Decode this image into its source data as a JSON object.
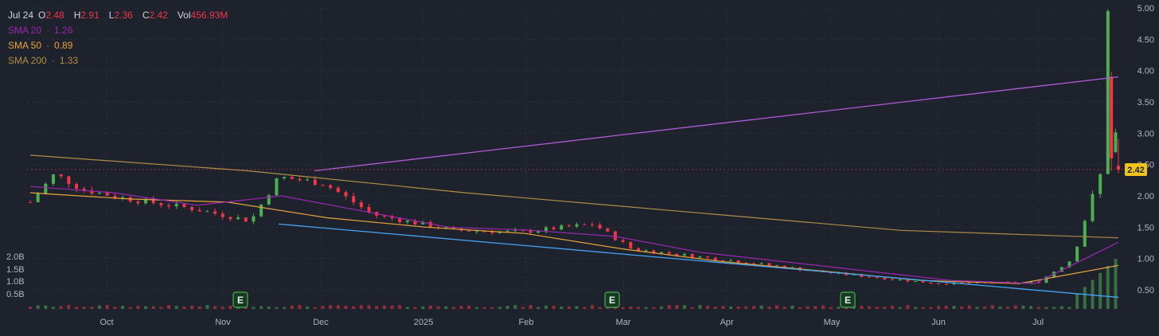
{
  "legend": {
    "date": "Jul 24",
    "ohlc": [
      {
        "key": "O",
        "value": "2.48"
      },
      {
        "key": "H",
        "value": "2.91"
      },
      {
        "key": "L",
        "value": "2.36"
      },
      {
        "key": "C",
        "value": "2.42"
      },
      {
        "key": "Vol",
        "value": "456.93M"
      }
    ],
    "sma": [
      {
        "label": "SMA 20",
        "value": "1.26",
        "color": "#9c27b0"
      },
      {
        "label": "SMA 50",
        "value": "0.89",
        "color": "#e8a33a"
      },
      {
        "label": "SMA 200",
        "value": "1.33",
        "color": "#b08d45"
      }
    ]
  },
  "colors": {
    "up": "#26a69a",
    "up_candle": "#4caf50",
    "down": "#f23645",
    "grid": "#2a2e39",
    "background": "#1e222d",
    "trend_upper": "#b05bd8",
    "trend_lower": "#42a5f5",
    "price_badge": "#f0c419"
  },
  "chart_data": {
    "type": "candlestick",
    "x_tick_labels": [
      "Oct",
      "Nov",
      "Dec",
      "2025",
      "Feb",
      "Mar",
      "Apr",
      "May",
      "Jun",
      "Jul"
    ],
    "y_tick_labels": [
      "5.00",
      "4.50",
      "4.00",
      "3.50",
      "3.00",
      "2.50",
      "2.00",
      "1.50",
      "1.00",
      "0.50"
    ],
    "ylim": [
      0.3,
      5.0
    ],
    "volume_tick_labels": [
      "2.0B",
      "1.5B",
      "1.0B",
      "0.5B"
    ],
    "last_price": "2.42",
    "earnings_markers": [
      "E",
      "E",
      "E"
    ],
    "price_path": [
      {
        "date": "Sep 16",
        "close": 1.9
      },
      {
        "date": "Sep 23",
        "close": 2.35
      },
      {
        "date": "Oct 1",
        "close": 2.1
      },
      {
        "date": "Oct 14",
        "close": 1.95
      },
      {
        "date": "Nov 1",
        "close": 1.8
      },
      {
        "date": "Nov 18",
        "close": 1.6
      },
      {
        "date": "Nov 26",
        "close": 2.3
      },
      {
        "date": "Dec 9",
        "close": 2.2
      },
      {
        "date": "Dec 23",
        "close": 1.7
      },
      {
        "date": "Jan 15",
        "close": 1.45
      },
      {
        "date": "Feb 3",
        "close": 1.42
      },
      {
        "date": "Feb 24",
        "close": 1.55
      },
      {
        "date": "Mar 7",
        "close": 1.15
      },
      {
        "date": "Apr 7",
        "close": 0.95
      },
      {
        "date": "May 1",
        "close": 0.78
      },
      {
        "date": "Jun 2",
        "close": 0.6
      },
      {
        "date": "Jul 1",
        "close": 0.62
      },
      {
        "date": "Jul 11",
        "close": 1.0
      },
      {
        "date": "Jul 16",
        "close": 1.9
      },
      {
        "date": "Jul 21",
        "close": 2.7
      },
      {
        "date": "Jul 22",
        "close": 3.9
      },
      {
        "date": "Jul 24",
        "close": 2.42
      }
    ],
    "sma20": [
      2.15,
      2.05,
      1.85,
      2.0,
      1.75,
      1.5,
      1.45,
      1.35,
      1.1,
      0.95,
      0.8,
      0.65,
      0.6,
      1.26
    ],
    "sma50": [
      2.05,
      1.95,
      1.9,
      1.65,
      1.5,
      1.4,
      1.15,
      0.95,
      0.8,
      0.65,
      0.6,
      0.89
    ],
    "sma200": [
      2.65,
      2.4,
      2.05,
      1.75,
      1.45,
      1.33
    ]
  }
}
